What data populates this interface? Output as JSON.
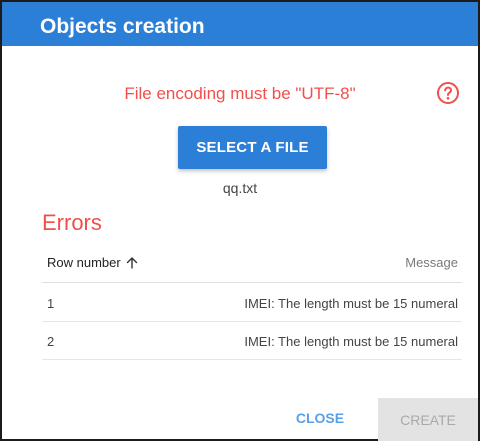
{
  "dialog": {
    "title": "Objects creation",
    "encoding_note": "File encoding must be \"UTF-8\"",
    "help_icon": "question-circle-icon",
    "select_file_label": "SELECT A FILE",
    "file_name": "qq.txt"
  },
  "errors": {
    "heading": "Errors",
    "columns": {
      "row_number": "Row number",
      "message": "Message"
    },
    "sort_icon": "arrow-up-icon",
    "rows": [
      {
        "number": "1",
        "message": "IMEI: The length must be 15 numeral"
      },
      {
        "number": "2",
        "message": "IMEI: The length must be 15 numeral"
      }
    ]
  },
  "actions": {
    "close_label": "CLOSE",
    "create_label": "CREATE",
    "create_enabled": false
  },
  "colors": {
    "primary": "#2b7fd6",
    "error": "#f0504b",
    "link": "#5aa0e6",
    "disabled_bg": "#e3e3e3",
    "disabled_text": "#a9a9a9"
  }
}
